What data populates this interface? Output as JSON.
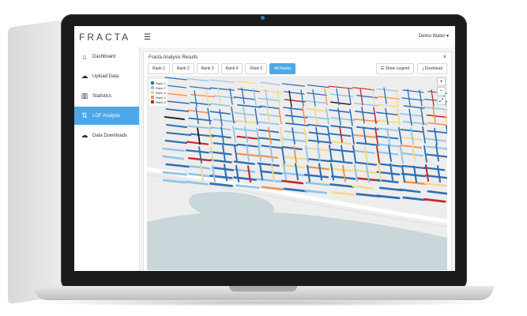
{
  "app": {
    "logo": "FRACTA",
    "menu_icon": "hamburger-icon",
    "user": "Demo Water ▾"
  },
  "sidebar": {
    "items": [
      {
        "label": "Dashboard",
        "icon": "home-icon",
        "glyph": "⌂"
      },
      {
        "label": "Upload Data",
        "icon": "cloud-upload-icon",
        "glyph": "☁"
      },
      {
        "label": "Statistics",
        "icon": "bar-chart-icon",
        "glyph": "▥"
      },
      {
        "label": "LOF Analysis",
        "icon": "sort-icon",
        "glyph": "⇅",
        "active": true
      },
      {
        "label": "Data Downloads",
        "icon": "cloud-download-icon",
        "glyph": "☁"
      }
    ]
  },
  "panel": {
    "title": "Fracta Analysis Results",
    "close": "×",
    "tabs": [
      "Rank 1",
      "Rank 2",
      "Rank 3",
      "Rank 4",
      "Rank 5",
      "All Ranks"
    ],
    "active_tab": "All Ranks",
    "show_legend": "Show Legend",
    "download": "Download"
  },
  "legend": [
    {
      "label": "Rank 1",
      "color": "#2f6fb3"
    },
    {
      "label": "Rank 2",
      "color": "#8fc4e8"
    },
    {
      "label": "Rank 3",
      "color": "#f3d98b"
    },
    {
      "label": "Rank 4",
      "color": "#f0944e"
    },
    {
      "label": "Rank 5",
      "color": "#c62828"
    }
  ],
  "zoom": {
    "in": "+",
    "out": "−",
    "fullscreen": "⤢"
  }
}
